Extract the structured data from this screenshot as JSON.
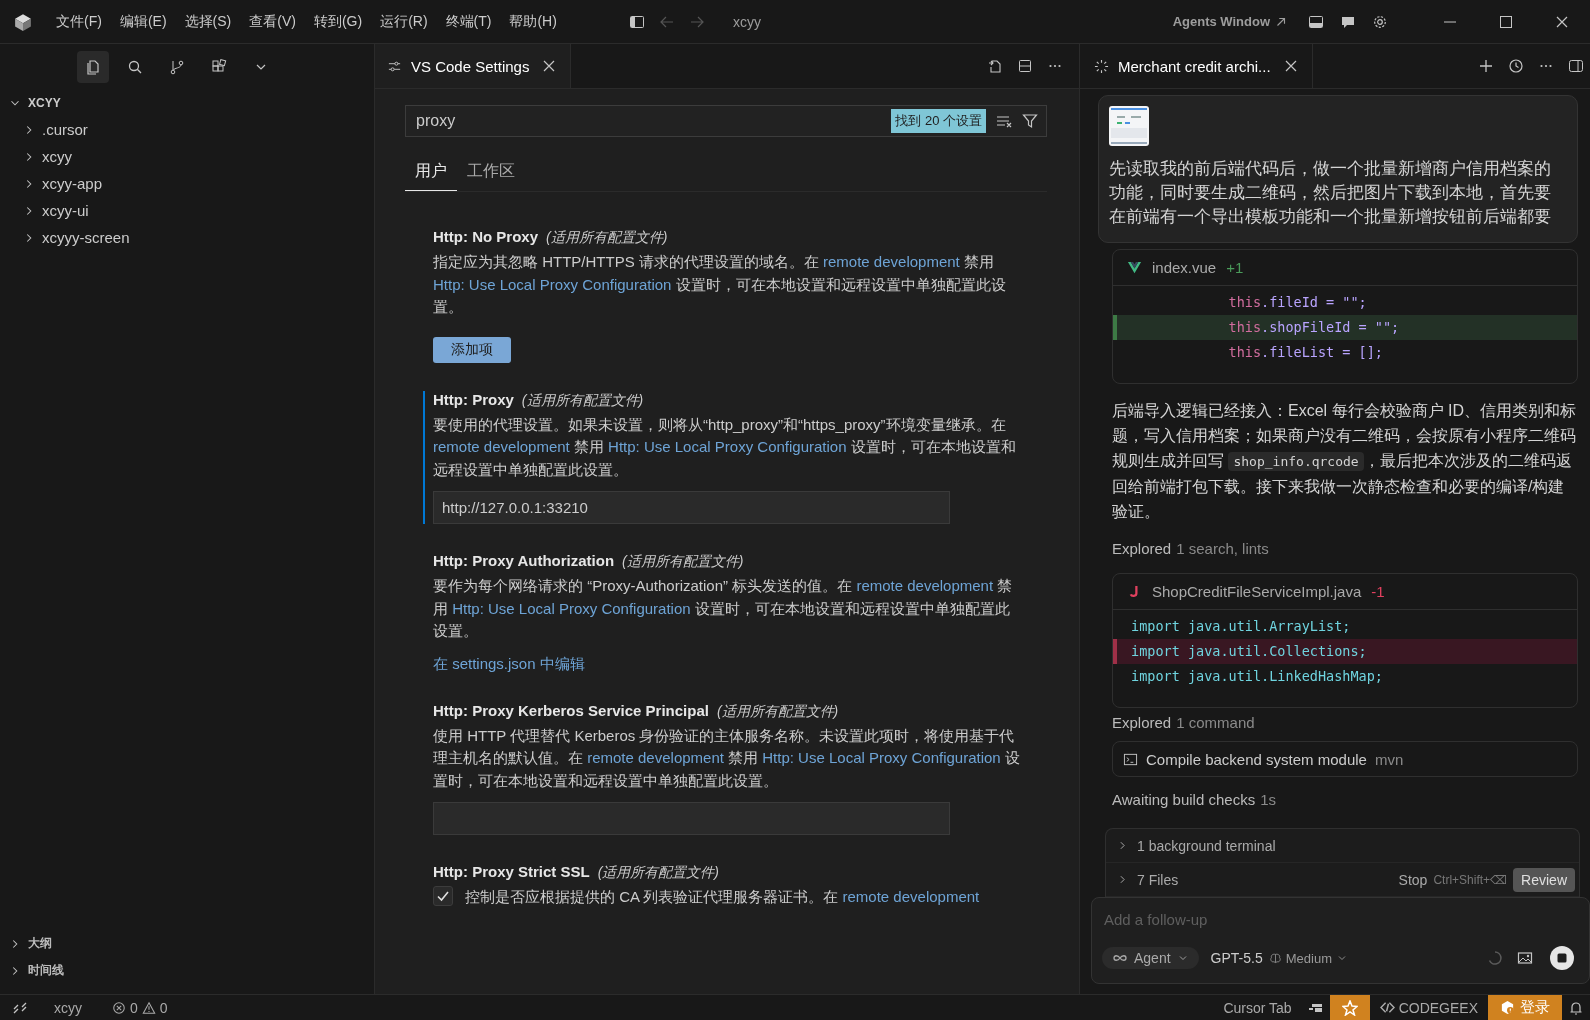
{
  "title_bar": {
    "menus": [
      "文件(F)",
      "编辑(E)",
      "选择(S)",
      "查看(V)",
      "转到(G)",
      "运行(R)",
      "终端(T)",
      "帮助(H)"
    ],
    "title": "xcyy",
    "agents_link": "Agents Window"
  },
  "sidebar": {
    "folder": {
      "label": "XCYY",
      "expanded": true,
      "children": [
        {
          "label": ".cursor",
          "expanded": false
        },
        {
          "label": "xcyy",
          "expanded": false
        },
        {
          "label": "xcyy-app",
          "expanded": false
        },
        {
          "label": "xcyy-ui",
          "expanded": false
        },
        {
          "label": "xcyyy-screen",
          "expanded": false
        }
      ]
    },
    "sections": [
      {
        "label": "大纲",
        "expanded": false
      },
      {
        "label": "时间线",
        "expanded": false
      }
    ]
  },
  "editor": {
    "tab": {
      "title": "VS Code Settings"
    },
    "search": {
      "value": "proxy",
      "result_count": "找到 20 个设置"
    },
    "scope_tabs": [
      {
        "label": "用户",
        "selected": true
      },
      {
        "label": "工作区",
        "selected": false
      }
    ],
    "settings": [
      {
        "kind": "list",
        "title": "Http: No Proxy",
        "scope": "(适用所有配置文件)",
        "focused": false,
        "description": [
          {
            "kind": "text",
            "text": "指定应为其忽略 HTTP/HTTPS 请求的代理设置的域名。在 "
          },
          {
            "kind": "link",
            "text": "remote development"
          },
          {
            "kind": "text",
            "text": " 禁用 "
          },
          {
            "kind": "link",
            "text": "Http: Use Local Proxy Configuration"
          },
          {
            "kind": "text",
            "text": " 设置时，可在本地设置和远程设置中单独配置此设置。"
          }
        ],
        "button": "添加项"
      },
      {
        "kind": "text",
        "title": "Http: Proxy",
        "scope": "(适用所有配置文件)",
        "focused": true,
        "description": [
          {
            "kind": "text",
            "text": "要使用的代理设置。如果未设置，则将从“http_proxy”和“https_proxy”环境变量继承。在 "
          },
          {
            "kind": "link",
            "text": "remote development"
          },
          {
            "kind": "text",
            "text": " 禁用 "
          },
          {
            "kind": "link",
            "text": "Http: Use Local Proxy Configuration"
          },
          {
            "kind": "text",
            "text": " 设置时，可在本地设置和远程设置中单独配置此设置。"
          }
        ],
        "value": "http://127.0.0.1:33210"
      },
      {
        "kind": "json",
        "title": "Http: Proxy Authorization",
        "scope": "(适用所有配置文件)",
        "focused": false,
        "description": [
          {
            "kind": "text",
            "text": "要作为每个网络请求的 “Proxy-Authorization” 标头发送的值。在 "
          },
          {
            "kind": "link",
            "text": "remote development"
          },
          {
            "kind": "text",
            "text": " 禁用 "
          },
          {
            "kind": "link",
            "text": "Http: Use Local Proxy Configuration"
          },
          {
            "kind": "text",
            "text": " 设置时，可在本地设置和远程设置中单独配置此设置。"
          }
        ],
        "edit_link": "在 settings.json 中编辑"
      },
      {
        "kind": "text",
        "title": "Http: Proxy Kerberos Service Principal",
        "scope": "(适用所有配置文件)",
        "focused": false,
        "description": [
          {
            "kind": "text",
            "text": "使用 HTTP 代理替代 Kerberos 身份验证的主体服务名称。未设置此项时，将使用基于代理主机名的默认值。在 "
          },
          {
            "kind": "link",
            "text": "remote development"
          },
          {
            "kind": "text",
            "text": " 禁用 "
          },
          {
            "kind": "link",
            "text": "Http: Use Local Proxy Configuration"
          },
          {
            "kind": "text",
            "text": " 设置时，可在本地设置和远程设置中单独配置此设置。"
          }
        ]
      },
      {
        "kind": "checkbox",
        "title": "Http: Proxy Strict SSL",
        "scope": "(适用所有配置文件)",
        "focused": false,
        "checked": true,
        "description": [
          {
            "kind": "text",
            "text": "控制是否应根据提供的 CA 列表验证代理服务器证书。在 "
          },
          {
            "kind": "link",
            "text": "remote development"
          }
        ]
      }
    ]
  },
  "chat": {
    "tab": {
      "title": "Merchant credit archi..."
    },
    "user_message": {
      "text": "先读取我的前后端代码后，做一个批量新增商户信用档案的功能，同时要生成二维码，然后把图片下载到本地，首先要在前端有一个导出模板功能和一个批量新增按钮前后端都要"
    },
    "items": [
      {
        "kind": "vuediff",
        "file": "index.vue",
        "change": "+1",
        "lines": [
          {
            "kind": "context",
            "text": "            this.fileId = \"\";"
          },
          {
            "kind": "added",
            "text": "            this.shopFileId = \"\";"
          },
          {
            "kind": "context",
            "text": "            this.fileList = [];"
          }
        ]
      },
      {
        "kind": "paragraph",
        "segments": [
          {
            "kind": "text",
            "text": "后端导入逻辑已经接入：Excel 每行会校验商户 ID、信用类别和标题，写入信用档案；如果商户没有二维码，会按原有小程序二维码规则生成并回写 "
          },
          {
            "kind": "code",
            "text": "shop_info.qrcode"
          },
          {
            "kind": "text",
            "text": "，最后把本次涉及的二维码返回给前端打包下载。接下来我做一次静态检查和必要的编译/构建验证。"
          }
        ]
      },
      {
        "kind": "status",
        "label": "Explored",
        "detail": "1 search, lints"
      },
      {
        "kind": "javadiff",
        "file": "ShopCreditFileServiceImpl.java",
        "change": "-1",
        "lines": [
          {
            "kind": "context",
            "text": "import java.util.ArrayList;"
          },
          {
            "kind": "removed",
            "text": "import java.util.Collections;"
          },
          {
            "kind": "context",
            "text": "import java.util.LinkedHashMap;"
          }
        ]
      },
      {
        "kind": "status",
        "label": "Explored",
        "detail": "1 command"
      },
      {
        "kind": "command",
        "label": "Compile backend system module",
        "tool": "mvn"
      },
      {
        "kind": "status",
        "label": "Awaiting build checks",
        "detail": "1s"
      }
    ],
    "tray": {
      "rows": [
        {
          "label": "1 background terminal",
          "expanded": false
        },
        {
          "label": "7 Files",
          "expanded": false
        }
      ],
      "stop": "Stop",
      "shortcut": "Ctrl+Shift+⌫",
      "review": "Review"
    },
    "composer": {
      "placeholder": "Add a follow-up",
      "mode": "Agent",
      "model": "GPT-5.5",
      "effort": "Medium"
    }
  },
  "status_bar": {
    "workspace": "xcyy",
    "errors": "0",
    "warnings": "0",
    "cursor_tab": "Cursor Tab",
    "codegeex": "CODEGEEX",
    "login": "登录"
  }
}
